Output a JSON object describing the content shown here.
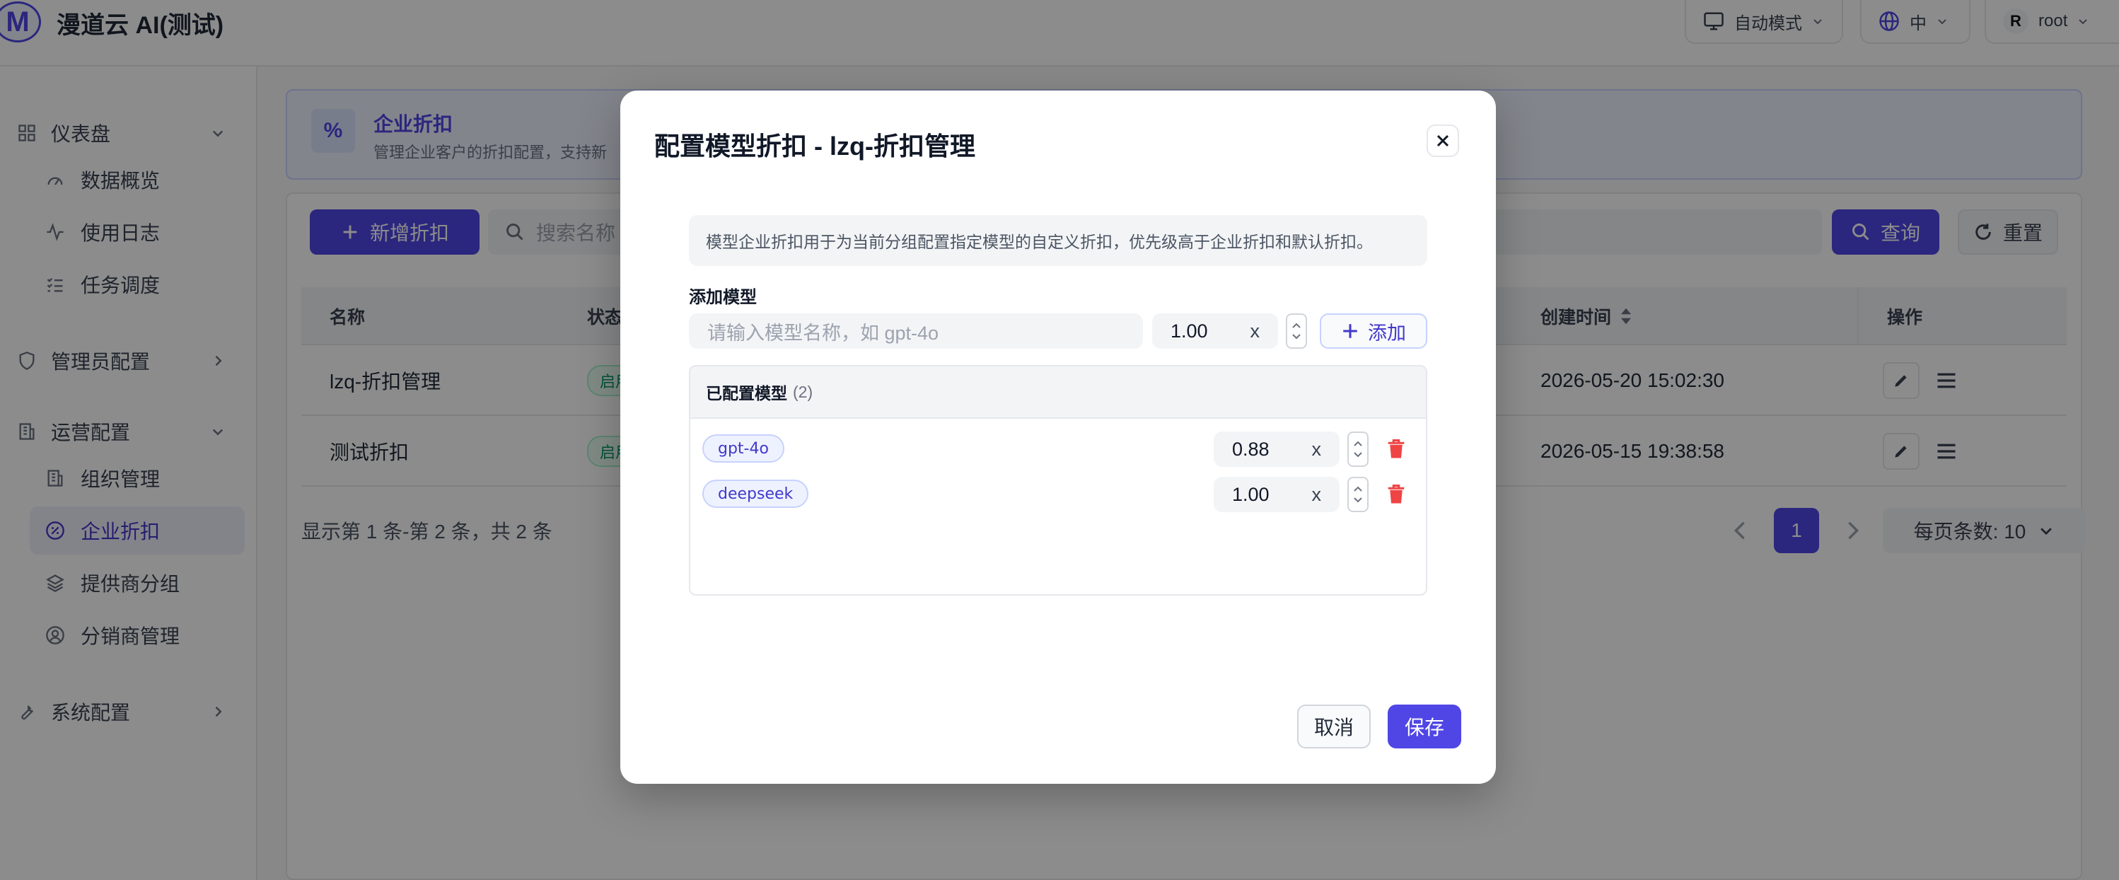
{
  "header": {
    "logo_letter": "M",
    "app_title": "漫道云 AI(测试)",
    "theme_mode": "自动模式",
    "language": "中",
    "user_avatar_letter": "R",
    "user_name": "root"
  },
  "sidebar": {
    "groups": [
      {
        "label": "仪表盘",
        "icon": "grid-icon",
        "expanded": true
      },
      {
        "label": "管理员配置",
        "icon": "shield-icon",
        "expanded": false
      },
      {
        "label": "运营配置",
        "icon": "building-icon",
        "expanded": true
      },
      {
        "label": "系统配置",
        "icon": "wrench-icon",
        "expanded": false
      }
    ],
    "items": [
      {
        "label": "数据概览",
        "icon": "gauge-icon"
      },
      {
        "label": "使用日志",
        "icon": "activity-icon"
      },
      {
        "label": "任务调度",
        "icon": "checklist-icon"
      },
      {
        "label": "组织管理",
        "icon": "building-icon"
      },
      {
        "label": "企业折扣",
        "icon": "discount-icon",
        "active": true
      },
      {
        "label": "提供商分组",
        "icon": "layers-icon"
      },
      {
        "label": "分销商管理",
        "icon": "user-circle-icon"
      }
    ]
  },
  "banner": {
    "icon": "%",
    "title": "企业折扣",
    "description": "管理企业客户的折扣配置，支持新"
  },
  "toolbar": {
    "add_label": "新增折扣",
    "search_placeholder": "搜索名称",
    "query_label": "查询",
    "reset_label": "重置"
  },
  "table": {
    "columns": [
      "名称",
      "状态",
      "创建时间",
      "操作"
    ],
    "rows": [
      {
        "name": "lzq-折扣管理",
        "status": "启用",
        "created": "2026-05-20 15:02:30"
      },
      {
        "name": "测试折扣",
        "status": "启用",
        "created": "2026-05-15 19:38:58"
      }
    ],
    "summary": "显示第 1 条-第 2 条，共 2 条",
    "current_page": "1",
    "page_size_label": "每页条数: 10"
  },
  "modal": {
    "title": "配置模型折扣 - lzq-折扣管理",
    "info": "模型企业折扣用于为当前分组配置指定模型的自定义折扣，优先级高于企业折扣和默认折扣。",
    "add_model_label": "添加模型",
    "model_input_placeholder": "请输入模型名称，如 gpt-4o",
    "new_discount_value": "1.00",
    "multiplier_symbol": "x",
    "add_button_label": "添加",
    "configured_title": "已配置模型",
    "configured_count": "(2)",
    "configured_models": [
      {
        "name": "gpt-4o",
        "discount": "0.88"
      },
      {
        "name": "deepseek",
        "discount": "1.00"
      }
    ],
    "cancel_label": "取消",
    "save_label": "保存"
  },
  "colors": {
    "primary": "#4f46e5",
    "danger": "#ef4444",
    "overlay": "rgba(0,0,0,0.45)"
  }
}
